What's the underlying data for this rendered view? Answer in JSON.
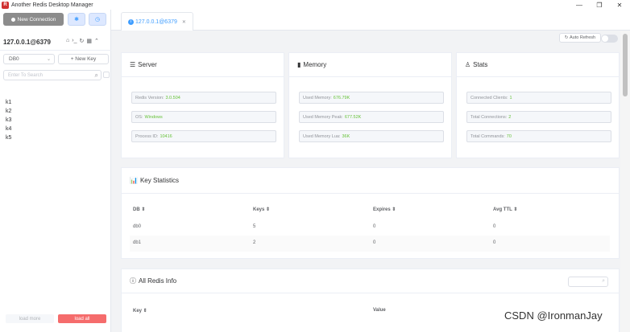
{
  "window": {
    "title": "Another Redis Desktop Manager",
    "logo_glyph": "R",
    "minimize_glyph": "—",
    "maximize_glyph": "❐",
    "close_glyph": "✕"
  },
  "sidebar": {
    "new_connection_label": "New Connection",
    "connection_name": "127.0.0.1@6379",
    "db_select_value": "DB0",
    "new_key_label": "+ New Key",
    "search_placeholder": "Enter To Search",
    "keys": [
      "k1",
      "k2",
      "k3",
      "k4",
      "k5"
    ],
    "load_more_label": "load more",
    "load_all_label": "load all"
  },
  "tabs": [
    {
      "label": "127.0.0.1@6379"
    }
  ],
  "toolbar": {
    "auto_refresh_label": "Auto Refresh",
    "auto_refresh_on": false
  },
  "server": {
    "title": "Server",
    "redis_version_label": "Redis Version:",
    "redis_version_value": "3.0.504",
    "os_label": "OS:",
    "os_value": "Windows",
    "process_id_label": "Process ID:",
    "process_id_value": "10416"
  },
  "memory": {
    "title": "Memory",
    "used_memory_label": "Used Memory:",
    "used_memory_value": "676.79K",
    "used_memory_peak_label": "Used Memory Peak:",
    "used_memory_peak_value": "677.52K",
    "used_memory_lua_label": "Used Memory Lua:",
    "used_memory_lua_value": "36K"
  },
  "stats": {
    "title": "Stats",
    "connected_clients_label": "Connected Clients:",
    "connected_clients_value": "1",
    "total_connections_label": "Total Connections:",
    "total_connections_value": "2",
    "total_commands_label": "Total Commands:",
    "total_commands_value": "70"
  },
  "key_statistics": {
    "title": "Key Statistics",
    "columns": [
      "DB",
      "Keys",
      "Expires",
      "Avg TTL"
    ],
    "rows": [
      [
        "db0",
        "5",
        "0",
        "0"
      ],
      [
        "db1",
        "2",
        "0",
        "0"
      ]
    ]
  },
  "redis_info": {
    "title": "All Redis Info",
    "columns": [
      "Key",
      "Value"
    ]
  },
  "watermark": "CSDN @IronmanJay",
  "colors": {
    "accent": "#409eff",
    "value_green": "#67c23a",
    "danger": "#f56c6c"
  }
}
